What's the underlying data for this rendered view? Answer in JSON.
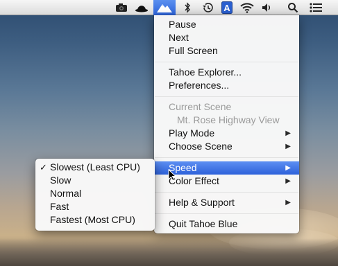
{
  "menubar": {
    "icons": [
      "camera-icon",
      "hat-icon",
      "tahoe-blue-mountain-icon",
      "bluetooth-icon",
      "time-machine-icon",
      "adium-icon",
      "wifi-icon",
      "volume-icon",
      "spotlight-search-icon",
      "notification-list-icon"
    ],
    "adium_letter": "A"
  },
  "main_menu": {
    "pause": "Pause",
    "next": "Next",
    "full_screen": "Full Screen",
    "tahoe_explorer": "Tahoe Explorer...",
    "preferences": "Preferences...",
    "current_scene": "Current Scene",
    "scene_name": "Mt. Rose Highway View",
    "play_mode": "Play Mode",
    "choose_scene": "Choose Scene",
    "speed": "Speed",
    "color_effect": "Color Effect",
    "help_support": "Help & Support",
    "quit": "Quit Tahoe Blue",
    "submenu_arrow": "▶"
  },
  "speed_submenu": {
    "selected_mark": "✓",
    "items": [
      "Slowest (Least CPU)",
      "Slow",
      "Normal",
      "Fast",
      "Fastest (Most CPU)"
    ],
    "selected": "Slowest (Least CPU)"
  },
  "colors": {
    "highlight": "#2d61da",
    "menubar": "#e8e8e8"
  }
}
